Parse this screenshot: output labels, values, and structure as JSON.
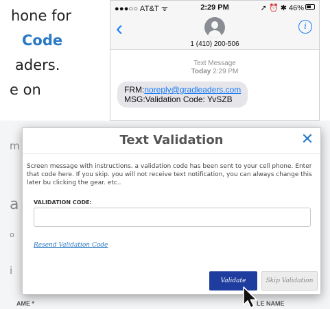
{
  "background_instructions": {
    "line1": "hone for",
    "line2": "Code",
    "line3": "aders.",
    "line4": "e on"
  },
  "phone": {
    "status": {
      "carrier": "●●●○○ AT&T ᯤ",
      "time": "2:29 PM",
      "right": "➚ ⏰ ✱ 46%"
    },
    "nav": {
      "back": "‹",
      "contact_number": "1 (410) 200-506",
      "info": "i"
    },
    "message_header": {
      "type": "Text Message",
      "date": "Today",
      "time": "2:29 PM"
    },
    "message": {
      "from_prefix": "FRM:",
      "from_email": "noreply@gradleaders.com",
      "body": "MSG:Validation Code: YvSZB"
    }
  },
  "bg_form": {
    "edge_letters": [
      "m",
      "a",
      "o",
      "i"
    ],
    "bottom_labels": [
      "AME *",
      "LE NAME"
    ]
  },
  "modal": {
    "title": "Text Validation",
    "close": "✕",
    "description": "Screen message with instructions. a validation code has been sent to your cell phone. Enter that code here. If you skip. you will not receive text notification, you can always change this later bu clicking the gear. etc..",
    "code_label": "VALIDATION CODE:",
    "code_value": "",
    "code_placeholder": "",
    "resend_link": "Resend Validation Code",
    "validate_button": "Validate",
    "skip_button": "Skip Validation"
  },
  "colors": {
    "accent_blue": "#2a79c5",
    "ios_blue": "#1a7cf5",
    "validate_bg": "#1f3d9e"
  },
  "icons": {
    "cursor": "arrow-cursor-icon",
    "close": "close-icon",
    "info": "info-icon",
    "back": "chevron-left-icon",
    "avatar": "contact-avatar-icon"
  }
}
